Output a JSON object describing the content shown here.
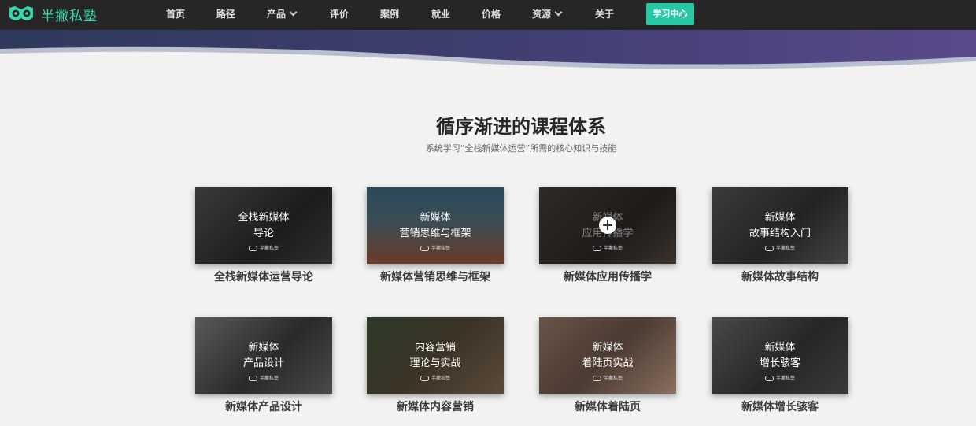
{
  "brand": {
    "name": "半撇私塾",
    "accent": "#27c9a5"
  },
  "nav": {
    "items": [
      {
        "label": "首页"
      },
      {
        "label": "路径"
      },
      {
        "label": "产品"
      },
      {
        "label": "评价"
      },
      {
        "label": "案例"
      },
      {
        "label": "就业"
      },
      {
        "label": "价格"
      },
      {
        "label": "资源"
      },
      {
        "label": "关于"
      }
    ],
    "cta_label": "学习中心"
  },
  "section": {
    "title": "循序渐进的课程体系",
    "subtitle": "系统学习“全栈新媒体运营”所需的核心知识与技能"
  },
  "courses": [
    {
      "line1": "全栈新媒体",
      "line2": "导论",
      "caption": "全栈新媒体运营导论",
      "brand": "半撇私塾"
    },
    {
      "line1": "新媒体",
      "line2": "营销思维与框架",
      "caption": "新媒体营销思维与框架",
      "brand": "半撇私塾"
    },
    {
      "line1": "新媒体",
      "line2": "应用传播学",
      "caption": "新媒体应用传播学",
      "brand": "半撇私塾"
    },
    {
      "line1": "新媒体",
      "line2": "故事结构入门",
      "caption": "新媒体故事结构",
      "brand": "半撇私塾"
    },
    {
      "line1": "新媒体",
      "line2": "产品设计",
      "caption": "新媒体产品设计",
      "brand": "半撇私塾"
    },
    {
      "line1": "内容营销",
      "line2": "理论与实战",
      "caption": "新媒体内容营销",
      "brand": "半撇私塾"
    },
    {
      "line1": "新媒体",
      "line2": "着陆页实战",
      "caption": "新媒体着陆页",
      "brand": "半撇私塾"
    },
    {
      "line1": "新媒体",
      "line2": "增长骇客",
      "caption": "新媒体增长骇客",
      "brand": "半撇私塾"
    }
  ]
}
